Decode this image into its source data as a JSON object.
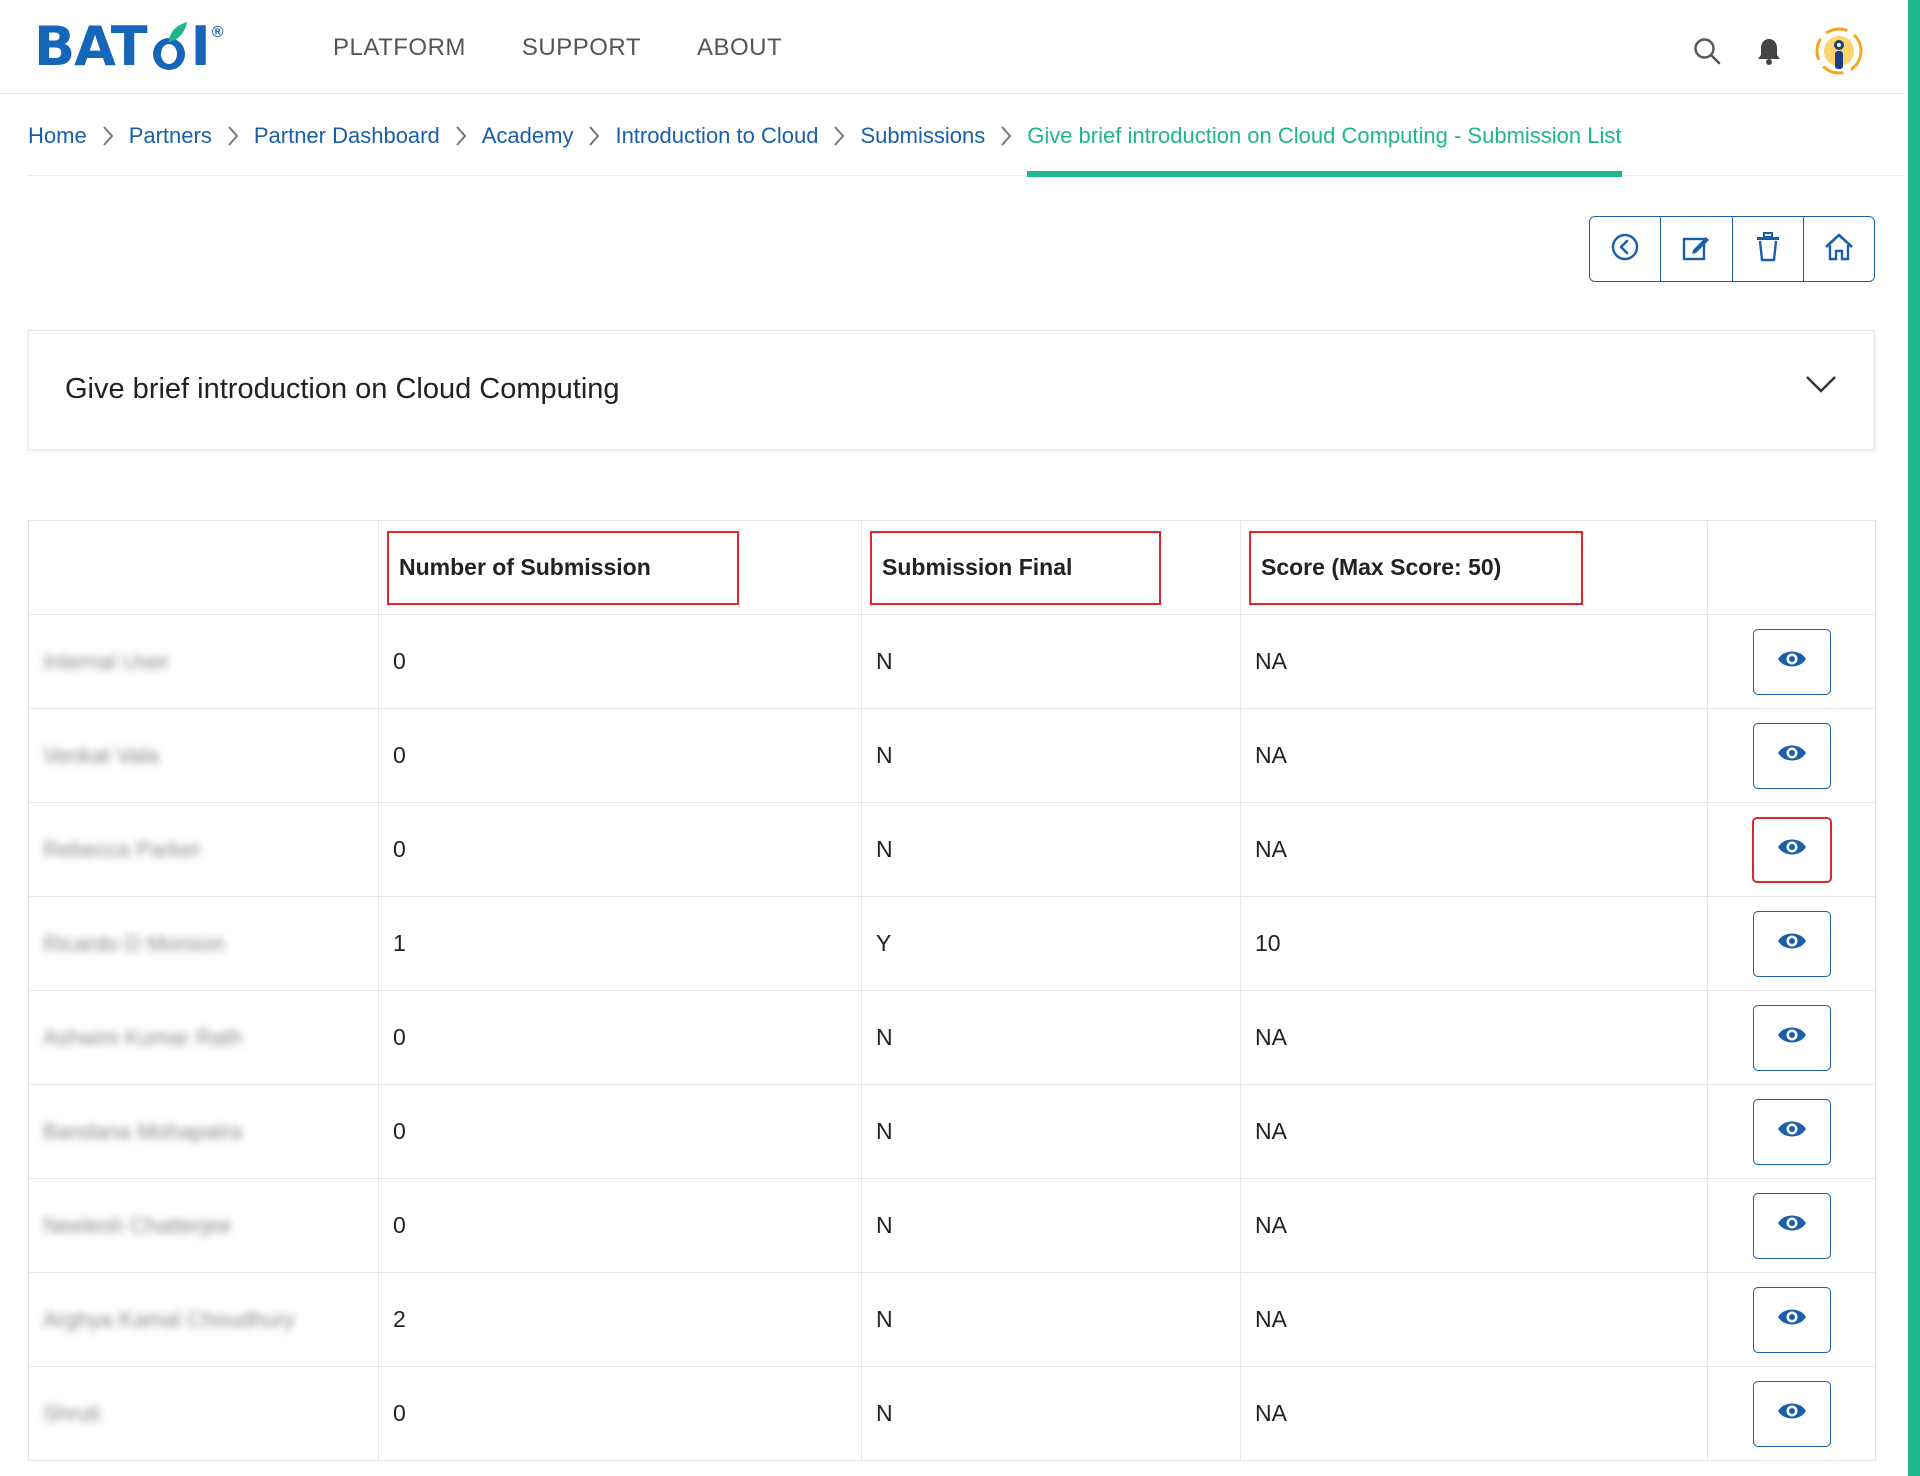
{
  "brand": {
    "logo_text_left": "BAT",
    "logo_text_right": "I",
    "registered": "®",
    "primary_color": "#1565b8",
    "accent_color": "#1fb58f"
  },
  "nav": {
    "items": [
      {
        "label": "PLATFORM"
      },
      {
        "label": "SUPPORT"
      },
      {
        "label": "ABOUT"
      }
    ]
  },
  "header_icons": [
    "search-icon",
    "bell-icon",
    "user-avatar"
  ],
  "breadcrumb": [
    {
      "label": "Home"
    },
    {
      "label": "Partners"
    },
    {
      "label": "Partner Dashboard"
    },
    {
      "label": "Academy"
    },
    {
      "label": "Introduction to Cloud"
    },
    {
      "label": "Submissions"
    },
    {
      "label": "Give brief introduction on Cloud Computing - Submission List"
    }
  ],
  "toolbar": {
    "buttons": [
      "back-icon",
      "edit-icon",
      "delete-icon",
      "home-icon"
    ]
  },
  "card": {
    "title": "Give brief introduction on Cloud Computing"
  },
  "table": {
    "columns": [
      "",
      "Number of Submission",
      "Submission Final",
      "Score (Max Score: 50)",
      ""
    ],
    "rows": [
      {
        "name": "Internal User",
        "submissions": "0",
        "final": "N",
        "score": "NA"
      },
      {
        "name": "Venkat Vala",
        "submissions": "0",
        "final": "N",
        "score": "NA"
      },
      {
        "name": "Rebecca Parker",
        "submissions": "0",
        "final": "N",
        "score": "NA"
      },
      {
        "name": "Ricardo D Monson",
        "submissions": "1",
        "final": "Y",
        "score": "10"
      },
      {
        "name": "Ashwini Kumar Rath",
        "submissions": "0",
        "final": "N",
        "score": "NA"
      },
      {
        "name": "Bandana Mohapatra",
        "submissions": "0",
        "final": "N",
        "score": "NA"
      },
      {
        "name": "Neelesh Chatterjee",
        "submissions": "0",
        "final": "N",
        "score": "NA"
      },
      {
        "name": "Arghya Kamal Choudhury",
        "submissions": "2",
        "final": "N",
        "score": "NA"
      },
      {
        "name": "Shruti",
        "submissions": "0",
        "final": "N",
        "score": "NA"
      }
    ]
  }
}
